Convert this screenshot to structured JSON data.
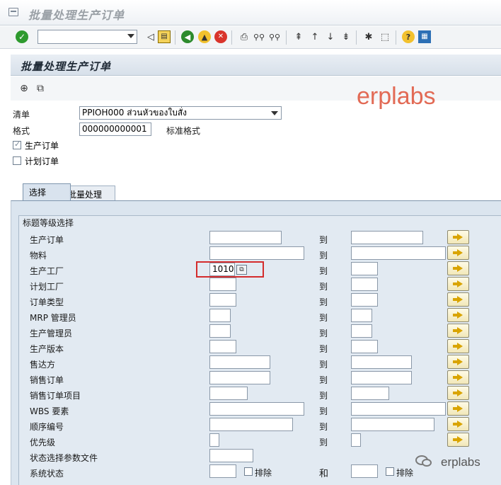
{
  "window": {
    "title": "批量处理生产订单"
  },
  "toolbar": {
    "command_field_value": "",
    "icons": [
      "enter-icon",
      "back-icon",
      "save-icon",
      "green-back-icon",
      "exit-icon",
      "cancel-icon",
      "print-icon",
      "find-icon",
      "find-next-icon",
      "first-page-icon",
      "previous-page-icon",
      "next-page-icon",
      "last-page-icon",
      "create-session-icon",
      "shortcut-icon",
      "help-icon",
      "customize-layout-icon"
    ]
  },
  "screen": {
    "title": "批量处理生产订单",
    "app_icons": [
      "execute-icon",
      "variant-icon"
    ]
  },
  "watermark": {
    "text": "erplabs",
    "bottom_text": "erplabs"
  },
  "header_fields": {
    "list_label": "清单",
    "list_value": "PPIOH000 ส่วนหัวของใบสั่ง",
    "format_label": "格式",
    "format_value": "000000000001",
    "format_desc": "标准格式",
    "production_orders_label": "生产订单",
    "production_orders_checked": true,
    "planned_orders_label": "计划订单",
    "planned_orders_checked": false
  },
  "tabs": [
    {
      "label": "选择",
      "active": true
    },
    {
      "label": "批量处理",
      "active": false
    }
  ],
  "selection": {
    "group_title": "标题等级选择",
    "to_label": "到",
    "and_label": "和",
    "exclude_label": "排除",
    "rows": [
      {
        "label": "生产订单",
        "from": "",
        "to": ""
      },
      {
        "label": "物料",
        "from": "",
        "to": ""
      },
      {
        "label": "生产工厂",
        "from": "1010",
        "to": ""
      },
      {
        "label": "计划工厂",
        "from": "",
        "to": ""
      },
      {
        "label": "订单类型",
        "from": "",
        "to": ""
      },
      {
        "label": "MRP 管理员",
        "from": "",
        "to": ""
      },
      {
        "label": "生产管理员",
        "from": "",
        "to": ""
      },
      {
        "label": "生产版本",
        "from": "",
        "to": ""
      },
      {
        "label": "售达方",
        "from": "",
        "to": ""
      },
      {
        "label": "销售订单",
        "from": "",
        "to": ""
      },
      {
        "label": "销售订单项目",
        "from": "",
        "to": ""
      },
      {
        "label": "WBS 要素",
        "from": "",
        "to": ""
      },
      {
        "label": "顺序编号",
        "from": "",
        "to": ""
      },
      {
        "label": "优先级",
        "from": "",
        "to": ""
      },
      {
        "label": "状态选择参数文件",
        "from": ""
      },
      {
        "label": "系统状态",
        "from": "",
        "to": ""
      }
    ]
  }
}
